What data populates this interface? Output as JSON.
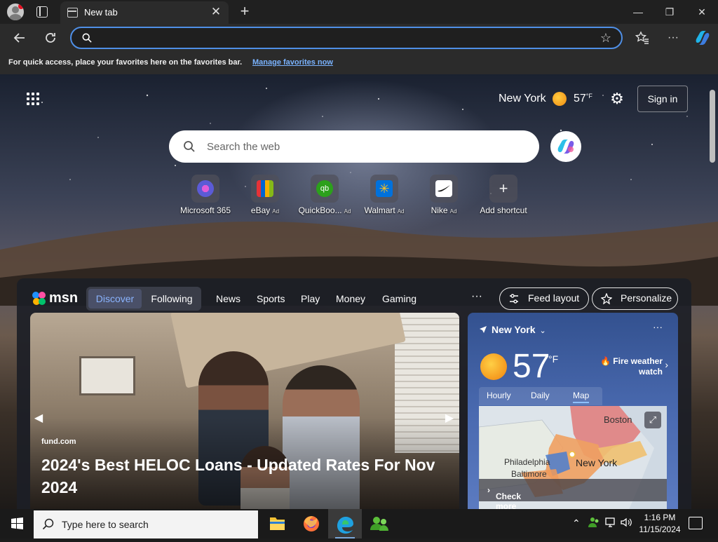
{
  "browser": {
    "tab_title": "New tab",
    "tab_close": "✕",
    "new_tab": "+",
    "window": {
      "minimize": "—",
      "restore": "❐",
      "close": "✕"
    },
    "address_value": "",
    "favorites_message": "For quick access, place your favorites here on the favorites bar.",
    "favorites_link": "Manage favorites now"
  },
  "ntp": {
    "weather": {
      "city": "New York",
      "temp": "57",
      "unit": "°F"
    },
    "sign_in": "Sign in",
    "search_placeholder": "Search the web",
    "shortcuts": [
      {
        "label": "Microsoft 365",
        "ad": "",
        "color": "#5b5bd6"
      },
      {
        "label": "eBay",
        "ad": "Ad",
        "color": "#e53238"
      },
      {
        "label": "QuickBoo...",
        "ad": "Ad",
        "color": "#2ca01c"
      },
      {
        "label": "Walmart",
        "ad": "Ad",
        "color": "#0071dc"
      },
      {
        "label": "Nike",
        "ad": "Ad",
        "color": "#111111"
      },
      {
        "label": "Add shortcut",
        "ad": "",
        "color": "#6b6b75"
      }
    ]
  },
  "feed": {
    "logo": "msn",
    "tabs": {
      "discover": "Discover",
      "following": "Following"
    },
    "nav": [
      "News",
      "Sports",
      "Play",
      "Money",
      "Gaming"
    ],
    "more": "···",
    "feed_layout": "Feed layout",
    "personalize": "Personalize",
    "hero": {
      "source": "fund.com",
      "headline": "2024's Best HELOC Loans - Updated Rates For Nov 2024"
    },
    "weather_card": {
      "location": "New York",
      "temp": "57",
      "unit": "°F",
      "alert": "Fire weather watch",
      "tabs": [
        "Hourly",
        "Daily",
        "Map"
      ],
      "active_tab": "Map",
      "map_labels": {
        "boston": "Boston",
        "philadelphia": "Philadelphia",
        "new_york": "New York",
        "baltimore": "Baltimore"
      },
      "map_link": "Check more alert details"
    }
  },
  "taskbar": {
    "search_placeholder": "Type here to search",
    "time": "1:16 PM",
    "date": "11/15/2024"
  }
}
